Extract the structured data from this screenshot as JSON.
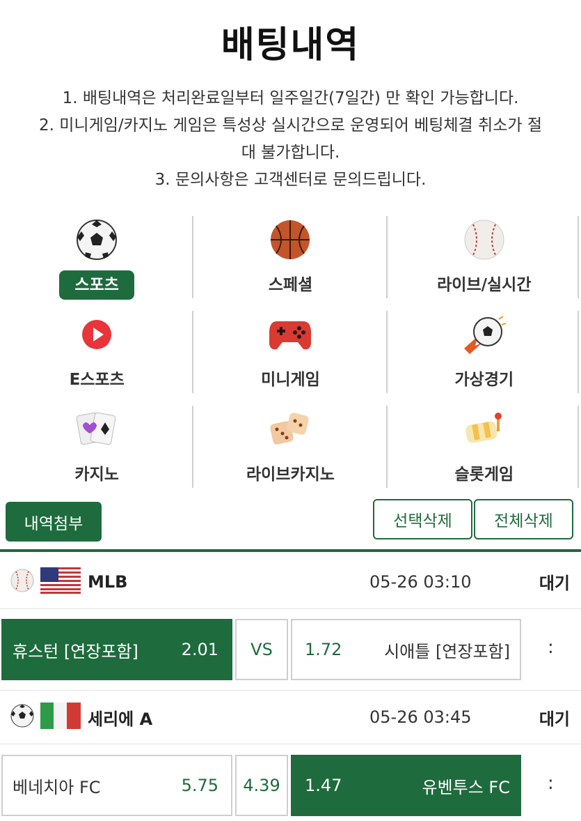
{
  "page": {
    "title": "배팅내역"
  },
  "notes": [
    "1. 배팅내역은 처리완료일부터 일주일간(7일간) 만 확인 가능합니다.",
    "2. 미니게임/카지노 게임은 특성상 실시간으로 운영되어 베팅체결 취소가 절",
    "대 불가합니다.",
    "3. 문의사항은 고객센터로 문의드립니다."
  ],
  "categories": [
    {
      "label": "스포츠",
      "icon": "soccer-ball-icon",
      "active": true
    },
    {
      "label": "스페셜",
      "icon": "basketball-icon",
      "active": false
    },
    {
      "label": "라이브/실시간",
      "icon": "baseball-icon",
      "active": false
    },
    {
      "label": "E스포츠",
      "icon": "play-icon",
      "active": false
    },
    {
      "label": "미니게임",
      "icon": "gamepad-icon",
      "active": false
    },
    {
      "label": "가상경기",
      "icon": "flying-ball-icon",
      "active": false
    },
    {
      "label": "카지노",
      "icon": "cards-icon",
      "active": false
    },
    {
      "label": "라이브카지노",
      "icon": "dice-icon",
      "active": false
    },
    {
      "label": "슬롯게임",
      "icon": "slot-reel-icon",
      "active": false
    }
  ],
  "actions": {
    "attach": "내역첨부",
    "delete_selected": "선택삭제",
    "delete_all": "전체삭제"
  },
  "matches": [
    {
      "sport_icon": "baseball-icon",
      "flag_icon": "us-flag-icon",
      "league": "MLB",
      "time": "05-26 03:10",
      "status": "대기",
      "home": {
        "name": "휴스턴 [연장포함]",
        "odds": "2.01"
      },
      "draw": "VS",
      "away": {
        "name": "시애틀 [연장포함]",
        "odds": "1.72"
      },
      "selected": "home",
      "result": ":"
    },
    {
      "sport_icon": "soccer-ball-icon",
      "flag_icon": "italy-flag-icon",
      "league": "세리에 A",
      "time": "05-26 03:45",
      "status": "대기",
      "home": {
        "name": "베네치아 FC",
        "odds": "5.75"
      },
      "draw": "4.39",
      "away": {
        "name": "유벤투스 FC",
        "odds": "1.47"
      },
      "selected": "away",
      "result": ":"
    }
  ],
  "colors": {
    "accent": "#1e6b3d",
    "border": "#cfcfcf"
  }
}
